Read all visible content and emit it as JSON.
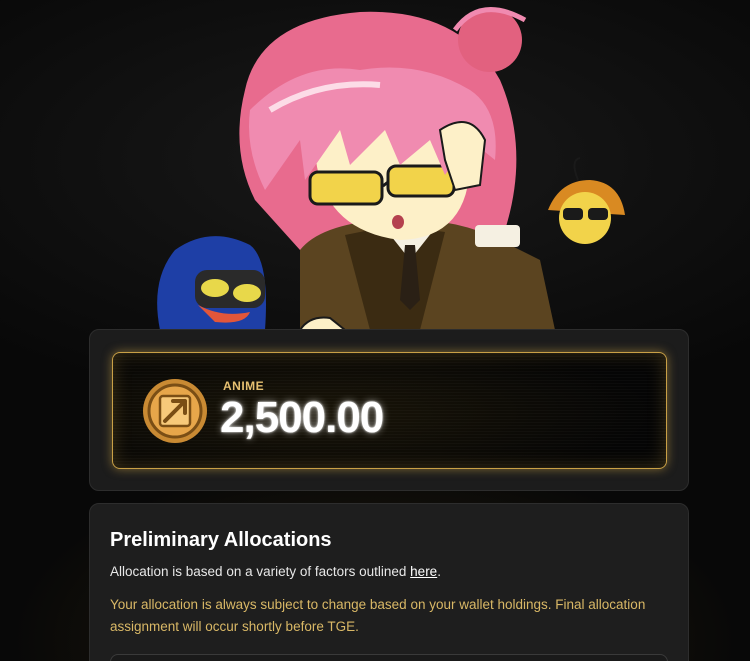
{
  "balance": {
    "token_symbol": "ANIME",
    "amount": "2,500.00",
    "coin_icon": "anime-token-icon",
    "accent_color": "#c9a046"
  },
  "allocations": {
    "title": "Preliminary Allocations",
    "description_prefix": "Allocation is based on a variety of factors outlined ",
    "description_link": "here",
    "description_suffix": ".",
    "note": "Your allocation is always subject to change based on your wallet holdings. Final allocation assignment will occur shortly before TGE.",
    "note_color": "#d9b866"
  },
  "colors": {
    "background": "#0b0b0b",
    "panel": "#1c1c1c",
    "gold": "#e6c071"
  }
}
